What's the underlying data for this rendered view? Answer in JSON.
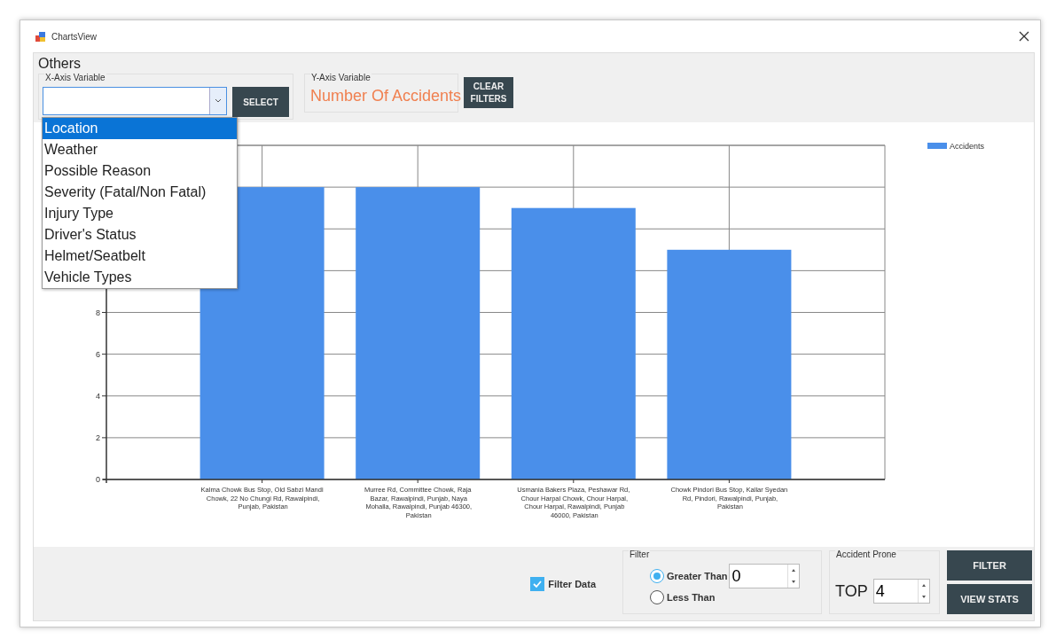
{
  "window": {
    "title": "ChartsView"
  },
  "others": {
    "title": "Others",
    "x_axis": {
      "label": "X-Axis Variable",
      "expanded": true,
      "options": [
        {
          "label": "Location",
          "selected": true
        },
        {
          "label": "Weather",
          "selected": false
        },
        {
          "label": "Possible Reason",
          "selected": false
        },
        {
          "label": "Severity (Fatal/Non Fatal)",
          "selected": false
        },
        {
          "label": "Injury Type",
          "selected": false
        },
        {
          "label": "Driver's Status",
          "selected": false
        },
        {
          "label": "Helmet/Seatbelt",
          "selected": false
        },
        {
          "label": "Vehicle Types",
          "selected": false
        }
      ]
    },
    "select_button": "SELECT",
    "y_axis": {
      "label": "Y-Axis Variable",
      "value": "Number Of Accidents"
    },
    "clear_button": "CLEAR FILTERS"
  },
  "chart": {
    "chart_data": {
      "type": "bar",
      "categories": [
        "Kalma Chowk Bus Stop, Old Sabzi Mandi Chowk, 22 No Chungi Rd, Rawalpindi, Punjab, Pakistan",
        "Murree Rd, Committee Chowk, Raja Bazar, Rawalpindi, Punjab, Naya Mohalla, Rawalpindi, Punjab 46300, Pakistan",
        "Usmania Bakers Plaza, Peshawar Rd, Chour Harpal Chowk, Chour Harpal, Chour Harpal, Rawalpindi, Punjab 46000, Pakistan",
        "Chowk Pindori Bus Stop, Kallar Syedan Rd, Pindori, Rawalpindi, Punjab, Pakistan"
      ],
      "series": [
        {
          "name": "Accidents",
          "color": "#4a8fea",
          "values": [
            14,
            14,
            13,
            11
          ]
        }
      ],
      "ylim": [
        0,
        16
      ],
      "yticks": [
        0,
        2,
        4,
        6,
        8
      ],
      "grid": true
    }
  },
  "bottom": {
    "filter_data": {
      "label": "Filter Data",
      "checked": true
    },
    "filter": {
      "title": "Filter",
      "options": [
        {
          "label": "Greater Than",
          "selected": true
        },
        {
          "label": "Less Than",
          "selected": false
        }
      ],
      "value": "0"
    },
    "accident_prone": {
      "title": "Accident Prone",
      "prefix": "TOP",
      "value": "4"
    },
    "buttons": [
      "FILTER",
      "VIEW STATS"
    ]
  }
}
